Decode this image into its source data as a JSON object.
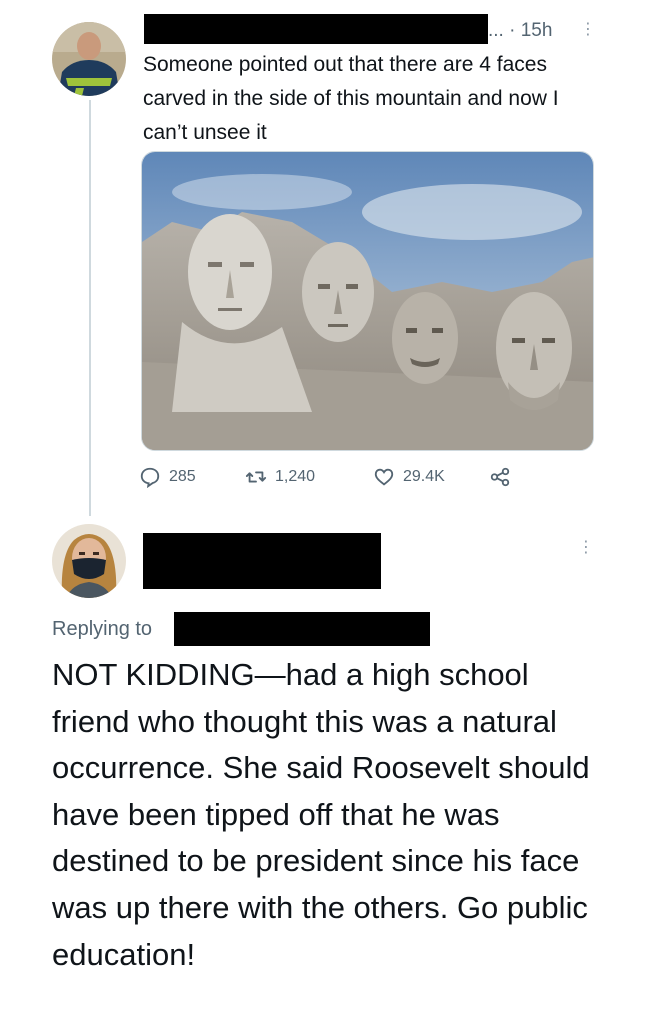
{
  "tweet": {
    "meta": "... · 15h",
    "text": "Someone pointed out that there are 4 faces carved in the side of this mountain and now I can’t unsee it",
    "avatar_icon": "user-avatar-jersey",
    "more_icon": "more-vertical-icon",
    "media_icon": "mount-rushmore-photo",
    "stats": {
      "replies": "285",
      "retweets": "1,240",
      "likes": "29.4K"
    },
    "icons": {
      "reply": "reply-icon",
      "retweet": "retweet-icon",
      "like": "heart-icon",
      "share": "share-icon"
    }
  },
  "reply": {
    "avatar_icon": "user-avatar-mask",
    "more_icon": "more-vertical-icon",
    "replying_to_label": "Replying to",
    "text": "NOT KIDDING—had a high school friend who thought this was a natural occurrence. She said Roosevelt should have been tipped off that he was destined to be president since his face was up there with the others. Go public education!"
  },
  "colors": {
    "text": "#0f1419",
    "muted": "#536471",
    "thread_line": "#cfd9de",
    "redaction": "#000000"
  }
}
